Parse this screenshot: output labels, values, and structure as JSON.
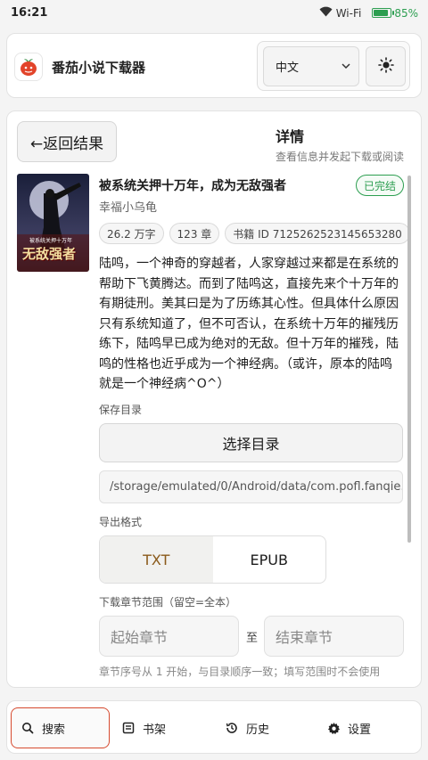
{
  "status_bar": {
    "time": "16:21",
    "wifi_label": "Wi-Fi",
    "battery_percent": "85%",
    "battery_level": 0.85
  },
  "app": {
    "title": "番茄小说下载器",
    "language": "中文"
  },
  "detail": {
    "back_label": "←返回结果",
    "title": "详情",
    "subtitle": "查看信息并发起下载或阅读"
  },
  "book": {
    "title": "被系统关押十万年，成为无敌强者",
    "status": "已完结",
    "author": "幸福小乌龟",
    "chips": [
      "26.2 万字",
      "123 章",
      "书籍 ID 7125262523145653280"
    ],
    "cover_text": "无敌强者",
    "cover_small_text": "被系统关押十万年",
    "description": "陆鸣，一个神奇的穿越者，人家穿越过来都是在系统的帮助下飞黄腾达。而到了陆鸣这，直接先来个十万年的有期徒刑。美其曰是为了历练其心性。但具体什么原因只有系统知道了，但不可否认，在系统十万年的摧残历练下，陆鸣早已成为绝对的无敌。但十万年的摧残，陆鸣的性格也近乎成为一个神经病。（或许，原本的陆鸣就是一个神经病^O^）"
  },
  "save": {
    "label": "保存目录",
    "choose_button": "选择目录",
    "path": "/storage/emulated/0/Android/data/com.pofl.fanqie…"
  },
  "export": {
    "label": "导出格式",
    "options": [
      "TXT",
      "EPUB"
    ],
    "selected": "TXT"
  },
  "range": {
    "label": "下载章节范围（留空=全本）",
    "start_placeholder": "起始章节",
    "separator": "至",
    "end_placeholder": "结束章节",
    "hint": "章节序号从 1 开始，与目录顺序一致；填写范围时不会使用"
  },
  "nav": {
    "items": [
      {
        "label": "搜索",
        "icon": "search-icon",
        "active": true
      },
      {
        "label": "书架",
        "icon": "bookshelf-icon",
        "active": false
      },
      {
        "label": "历史",
        "icon": "history-icon",
        "active": false
      },
      {
        "label": "设置",
        "icon": "gear-icon",
        "active": false
      }
    ]
  },
  "colors": {
    "accent": "#d64a2f",
    "success": "#2c9e50",
    "format_active_text": "#8a5a1a"
  }
}
